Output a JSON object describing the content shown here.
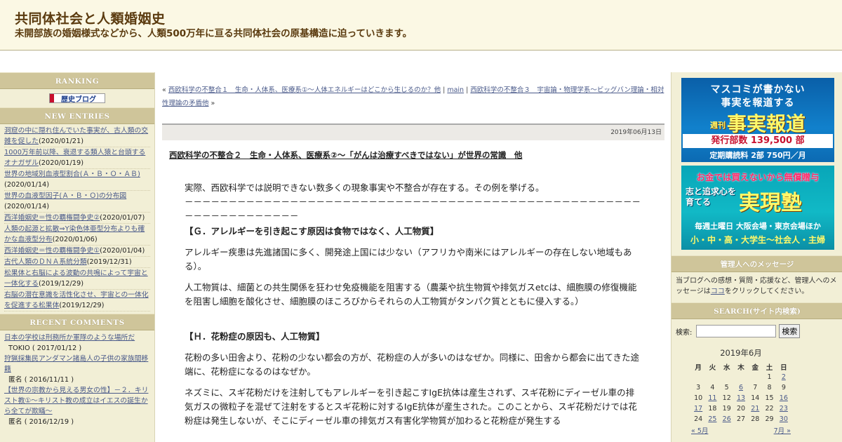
{
  "header": {
    "title": "共同体社会と人類婚姻史",
    "subtitle": "未開部族の婚姻様式などから、人類500万年に亘る共同体社会の原基構造に迫っていきます。"
  },
  "left": {
    "ranking_head": "RANKING",
    "ranking_banner": "歴史ブログ",
    "new_entries_head": "NEW ENTRIES",
    "entries": [
      {
        "title": "洞窟の中に隠れ住んでいた事実が、古人類の交雑を促した",
        "date": "(2020/01/21)"
      },
      {
        "title": "1000万年前以降、衰退する類人猿と台頭するオナガザル",
        "date": "(2020/01/19)"
      },
      {
        "title": "世界の地域別血液型割合(Ａ・Ｂ・Ｏ・ＡＢ)",
        "date": "(2020/01/14)"
      },
      {
        "title": "世界の血液型因子(Ａ・Ｂ・Ｏ)の分布図",
        "date": "(2020/01/14)"
      },
      {
        "title": "西洋婚姻史＝性の覇権闘争史②",
        "date": "(2020/01/07)"
      },
      {
        "title": "人類の起源と拡散⇒Y染色体亜型分布よりも確かな血液型分布",
        "date": "(2020/01/06)"
      },
      {
        "title": "西洋婚姻史＝性の覇権闘争史①",
        "date": "(2020/01/04)"
      },
      {
        "title": "古代人類のＤＮＡ系統分類",
        "date": "(2019/12/31)"
      },
      {
        "title": "松果体と右脳による波動の共鳴によって宇宙と一体化する",
        "date": "(2019/12/29)"
      },
      {
        "title": "右脳の潜在意識を活性化させ、宇宙との一体化を促進する松果体",
        "date": "(2019/12/29)"
      }
    ],
    "recent_comments_head": "RECENT COMMENTS",
    "comments": [
      {
        "title": "日本の学校は刑務所か軍隊のような場所だ",
        "by": "TOKIO ( 2017/01/12 )"
      },
      {
        "title": "狩猟採集民アンダマン諸島人の子供の家族間移籍",
        "by": "匿名 ( 2016/11/11 )"
      },
      {
        "title": "【世界の宗教から見える男女の性】－２．キリスト教①～キリスト教の成立はイエスの誕生から全てが欺瞞～",
        "by": "匿名 ( 2016/12/19 )"
      }
    ]
  },
  "main": {
    "nav_prev": "西欧科学の不整合１　生命・人体系、医療系①～人体エネルギーはどこから生じるのか？他",
    "nav_main": "main",
    "nav_next": "西欧科学の不整合３　宇宙論・物理学系～ビッグバン理論・相対性理論の矛盾他",
    "nav_open": "«",
    "nav_sep": "|",
    "nav_close": "»",
    "date": "2019年06月13日",
    "post_title": "西欧科学の不整合２　生命・人体系、医療系②～「がんは治療すべきではない」が世界の常識　他",
    "paragraphs": {
      "intro": "実際、西欧科学では説明できない数多くの現象事実や不整合が存在する。その例を挙げる。",
      "dash": "－－－－－－－－－－－－－－－－－－－－－－－－－－－－－－－－－－－－－－－－－－－－－－－－－－－－－－－－－－－－－－－－－",
      "heading_g": "【Ｇ．アレルギーを引き起こす原因は食物ではなく、人工物質】",
      "g1": "アレルギー疾患は先進諸国に多く、開発途上国には少ない（アフリカや南米にはアレルギーの存在しない地域もある）。",
      "g2": "人工物質は、細菌との共生関係を狂わせ免疫機能を阻害する（農薬や抗生物質や排気ガスetcは、細胞膜の修復機能を阻害し細胞を酸化させ、細胞膜のほころびからそれらの人工物質がタンパク質とともに侵入する。）",
      "heading_h": "【Ｈ．花粉症の原因も、人工物質】",
      "h1": "花粉の多い田舎より、花粉の少ない都会の方が、花粉症の人が多いのはなぜか。同様に、田舎から都会に出てきた途端に、花粉症になるのはなぜか。",
      "h2": "ネズミに、スギ花粉だけを注射してもアレルギーを引き起こすIgE抗体は産生されず、スギ花粉にディーゼル車の排気ガスの微粒子を混ぜて注射をするとスギ花粉に対するIgE抗体が産生された。このことから、スギ花粉だけでは花粉症は発生しないが、そこにディーゼル車の排気ガス有害化学物質が加わると花粉症が発生する"
    }
  },
  "right": {
    "ad1": {
      "line1": "マスコミが書かない",
      "line2": "事実を報道する",
      "weekly": "週刊",
      "big": "事実報道",
      "line3": "発行部数 139,500 部",
      "line4": "定期購読料 2部 750円／月"
    },
    "ad2": {
      "line1": "お金では買えないから無償贈与",
      "big_left": "志と追求心を育てる",
      "big": "実現塾",
      "line3": "毎週土曜日 大阪会場・東京会場ほか",
      "line4": "小・中・高・大学生～社会人・主婦"
    },
    "admin_head": "管理人へのメッセージ",
    "admin_msg_a": "当ブログへの感想・質問・応援など、管理人へのメッセージは",
    "admin_msg_link": "ココ",
    "admin_msg_b": "をクリックしてください。",
    "search_head": "SEARCH(サイト内検索)",
    "search_label": "検索:",
    "search_value": "",
    "search_button": "検索",
    "calendar": {
      "caption": "2019年6月",
      "weekdays": [
        "月",
        "火",
        "水",
        "木",
        "金",
        "土",
        "日"
      ],
      "weeks": [
        [
          "",
          "",
          "",
          "",
          "",
          "1",
          "2"
        ],
        [
          "3",
          "4",
          "5",
          "6",
          "7",
          "8",
          "9"
        ],
        [
          "10",
          "11",
          "12",
          "13",
          "14",
          "15",
          "16"
        ],
        [
          "17",
          "18",
          "19",
          "20",
          "21",
          "22",
          "23"
        ],
        [
          "24",
          "25",
          "26",
          "27",
          "28",
          "29",
          "30"
        ]
      ],
      "linked": [
        "2",
        "6",
        "11",
        "13",
        "16",
        "17",
        "21",
        "23",
        "25",
        "26",
        "30"
      ],
      "prev": "« 5月",
      "next": "7月 »"
    }
  }
}
